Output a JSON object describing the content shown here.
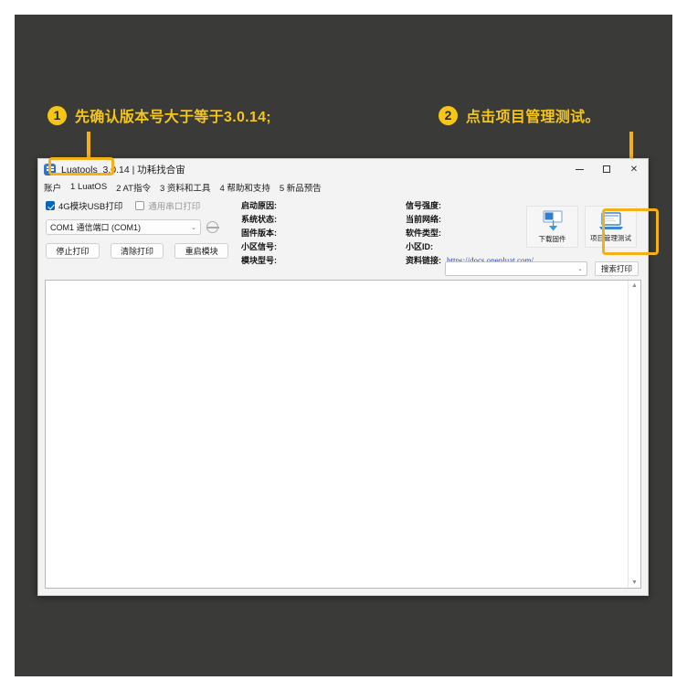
{
  "annotations": [
    {
      "number": "1",
      "text": "先确认版本号大于等于3.0.14;"
    },
    {
      "number": "2",
      "text": "点击项目管理测试。"
    }
  ],
  "window": {
    "title": "Luatools_3.0.14 | 功耗找合宙",
    "app_icon": "luatools-app-icon",
    "controls": {
      "minimize": "minimize-icon",
      "maximize": "maximize-icon",
      "close": "✕"
    },
    "menu": [
      "账户",
      "1 LuatOS",
      "2 AT指令",
      "3 资料和工具",
      "4 帮助和支持",
      "5 新品预告"
    ],
    "toolbar": {
      "checkbox_usb": {
        "label": "4G模块USB打印",
        "checked": true
      },
      "checkbox_serial": {
        "label": "通用串口打印",
        "checked": false
      },
      "port_combo": {
        "value": "COM1 通信端口 (COM1)",
        "caret": "⌄"
      },
      "refresh_icon": "refresh-icon",
      "buttons": [
        "停止打印",
        "清除打印",
        "重启模块"
      ],
      "info_middle": [
        {
          "label": "启动原因:",
          "value": ""
        },
        {
          "label": "系统状态:",
          "value": ""
        },
        {
          "label": "固件版本:",
          "value": ""
        },
        {
          "label": "小区信号:",
          "value": ""
        },
        {
          "label": "模块型号:",
          "value": ""
        }
      ],
      "info_right": [
        {
          "label": "信号强度:",
          "value": ""
        },
        {
          "label": "当前网络:",
          "value": ""
        },
        {
          "label": "软件类型:",
          "value": ""
        },
        {
          "label": "小区ID:",
          "value": ""
        },
        {
          "label": "资料链接:",
          "value": "",
          "link": "https://docs.openluat.com/"
        }
      ],
      "action_buttons": [
        {
          "label": "下载固件",
          "icon": "download-firmware-icon"
        },
        {
          "label": "项目管理测试",
          "icon": "project-manager-icon"
        }
      ],
      "search": {
        "combo_value": "",
        "caret": "⌄",
        "button_label": "搜索打印"
      }
    },
    "log": {
      "content": "",
      "scroll_up": "▲",
      "scroll_down": "▼"
    }
  },
  "colors": {
    "accent": "#f5b018",
    "badge": "#f5c518",
    "canvas": "#3a3a38",
    "window_bg": "#f3f3f3",
    "link": "#1747c7",
    "checkbox_checked": "#0067c0"
  }
}
